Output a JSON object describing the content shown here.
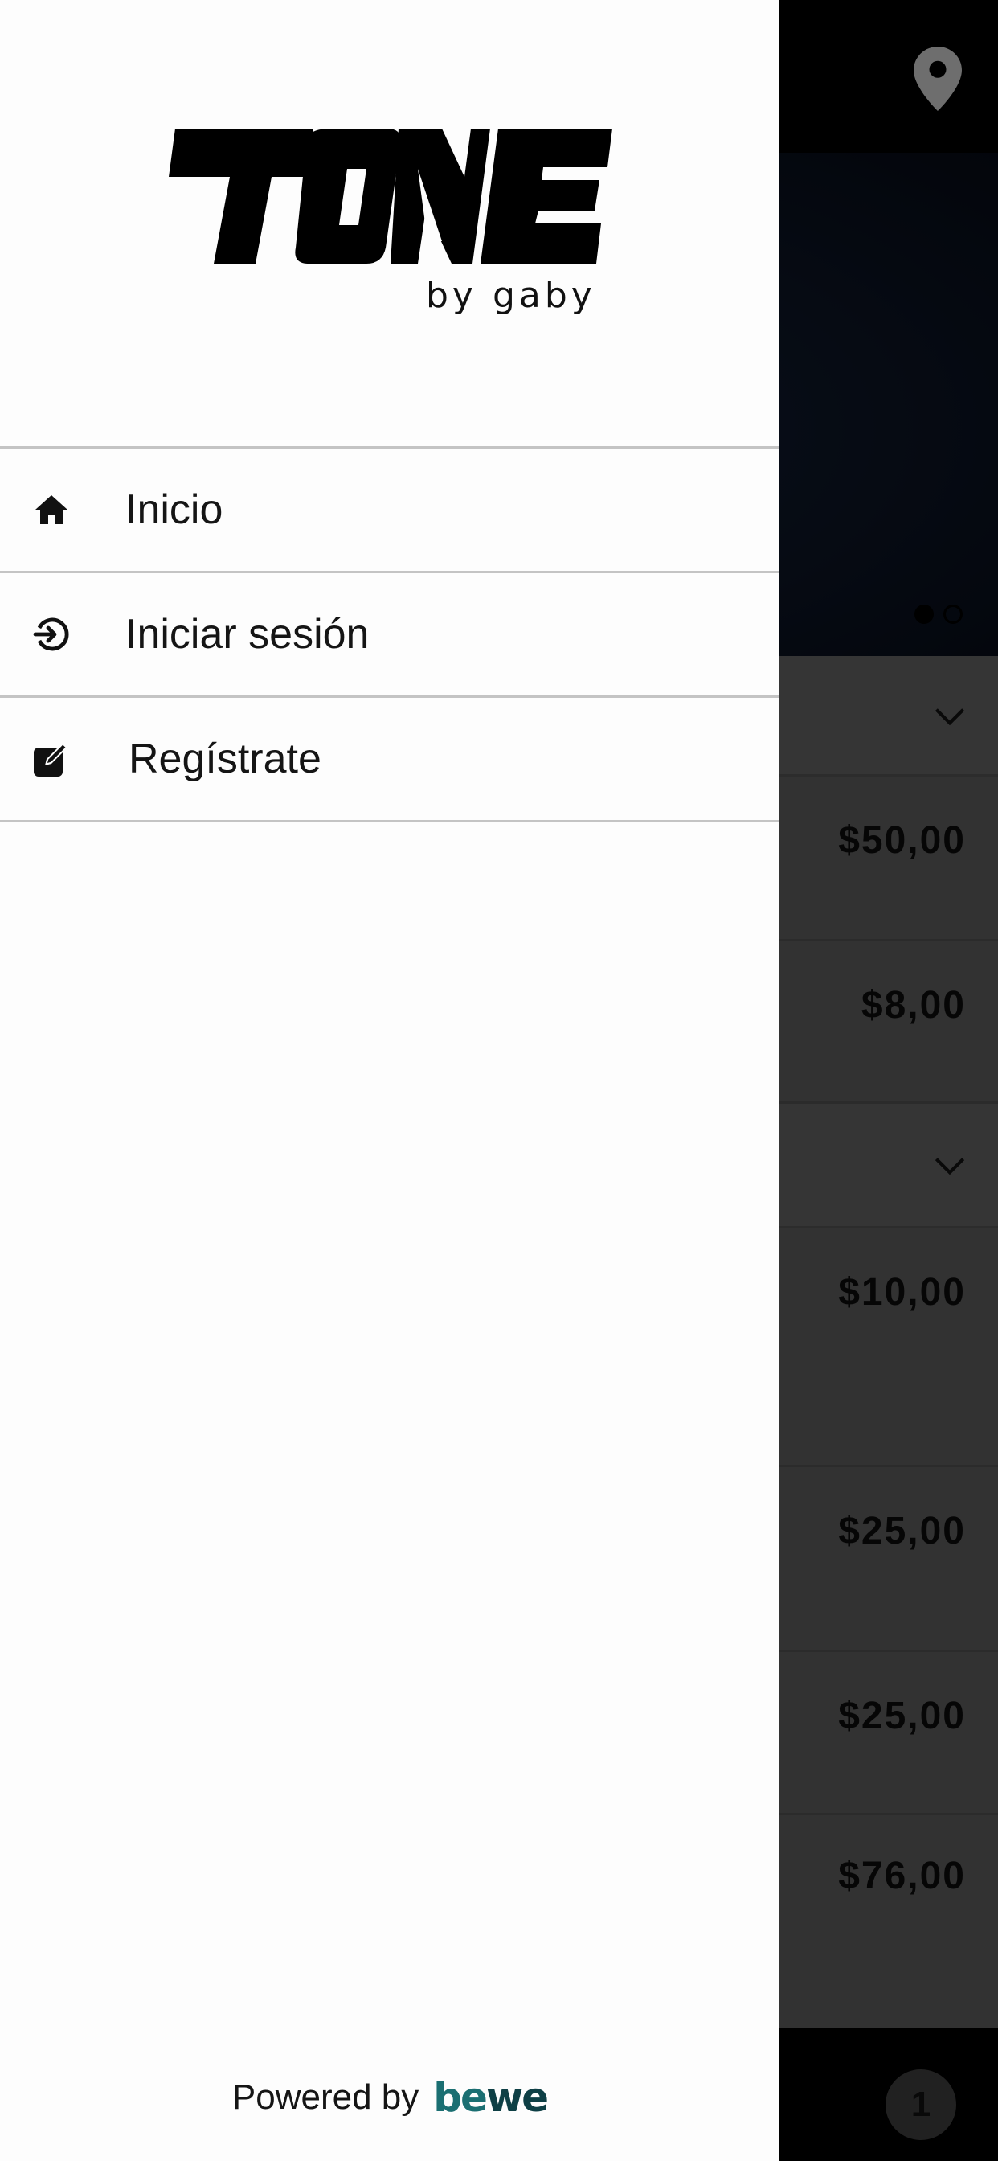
{
  "drawer": {
    "logo": {
      "wordmark": "TONE",
      "tagline": "by gaby"
    },
    "menu": [
      {
        "label": "Inicio",
        "icon": "home-icon"
      },
      {
        "label": "Iniciar sesión",
        "icon": "login-icon"
      },
      {
        "label": "Regístrate",
        "icon": "edit-icon"
      }
    ],
    "footer": {
      "powered_by": "Powered by",
      "brand_be": "be",
      "brand_we": "we"
    }
  },
  "background": {
    "header_icon": "location-pin-icon",
    "carousel": {
      "slides": 2,
      "active": 1
    },
    "prices": [
      "$50,00",
      "$8,00",
      "$10,00",
      "$25,00",
      "$25,00",
      "$76,00"
    ],
    "cart_count": "1"
  },
  "colors": {
    "drawer_bg": "#fdfdfd",
    "divider": "#c4c4c4",
    "brand_teal": "#1b6f72",
    "header_bg": "#000000"
  }
}
